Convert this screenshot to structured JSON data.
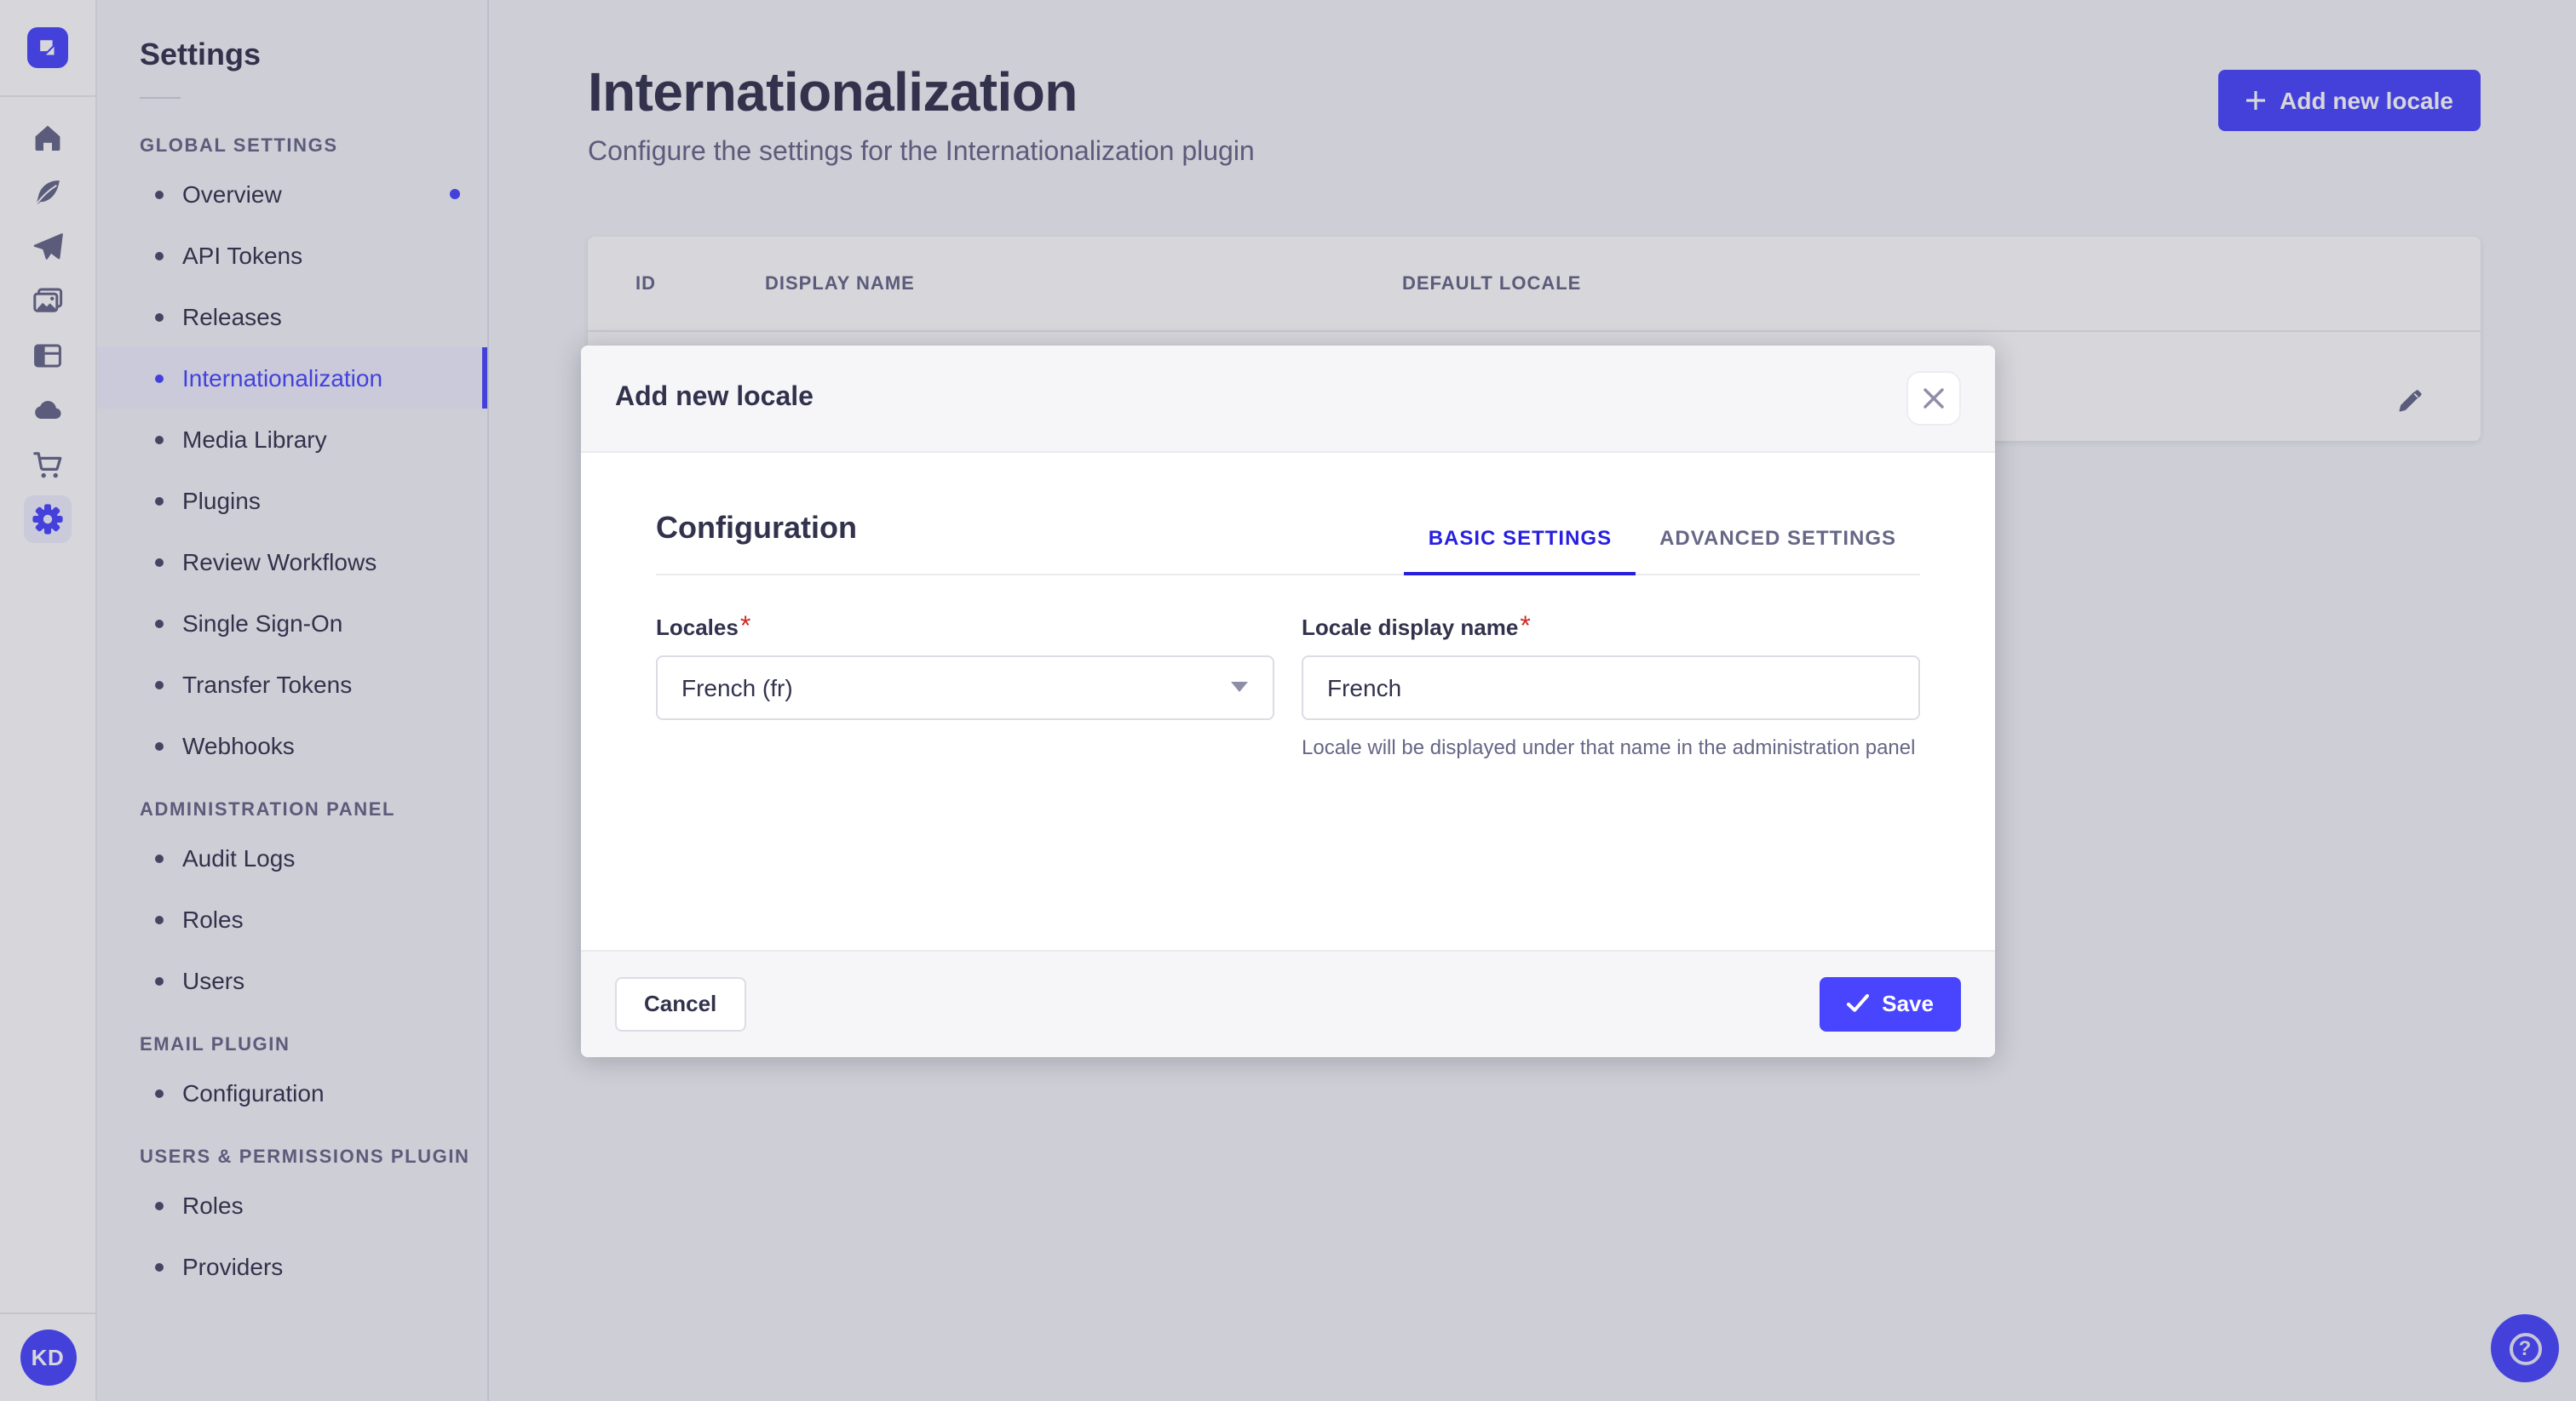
{
  "nav_rail": {
    "icons": [
      "home",
      "feather",
      "paper-plane",
      "media-library",
      "content-manager",
      "cloud",
      "marketplace-cart",
      "settings-gear"
    ],
    "active_icon": "settings-gear",
    "avatar_initials": "KD"
  },
  "sidebar": {
    "title": "Settings",
    "sections": [
      {
        "label": "GLOBAL SETTINGS",
        "items": [
          {
            "label": "Overview",
            "notification": true
          },
          {
            "label": "API Tokens"
          },
          {
            "label": "Releases"
          },
          {
            "label": "Internationalization",
            "active": true
          },
          {
            "label": "Media Library"
          },
          {
            "label": "Plugins"
          },
          {
            "label": "Review Workflows"
          },
          {
            "label": "Single Sign-On"
          },
          {
            "label": "Transfer Tokens"
          },
          {
            "label": "Webhooks"
          }
        ]
      },
      {
        "label": "ADMINISTRATION PANEL",
        "items": [
          {
            "label": "Audit Logs"
          },
          {
            "label": "Roles"
          },
          {
            "label": "Users"
          }
        ]
      },
      {
        "label": "EMAIL PLUGIN",
        "items": [
          {
            "label": "Configuration"
          }
        ]
      },
      {
        "label": "USERS & PERMISSIONS PLUGIN",
        "items": [
          {
            "label": "Roles"
          },
          {
            "label": "Providers"
          }
        ]
      }
    ]
  },
  "page": {
    "title": "Internationalization",
    "subtitle": "Configure the settings for the Internationalization plugin",
    "add_locale_button": "Add new locale"
  },
  "table": {
    "columns": [
      "ID",
      "DISPLAY NAME",
      "DEFAULT LOCALE"
    ]
  },
  "modal": {
    "title": "Add new locale",
    "section_title": "Configuration",
    "tabs": [
      {
        "label": "BASIC SETTINGS",
        "active": true
      },
      {
        "label": "ADVANCED SETTINGS",
        "active": false
      }
    ],
    "locales_field": {
      "label": "Locales",
      "required": "*",
      "value": "French (fr)"
    },
    "display_name_field": {
      "label": "Locale display name",
      "required": "*",
      "value": "French",
      "help": "Locale will be displayed under that name in the administration panel"
    },
    "footer": {
      "cancel": "Cancel",
      "save": "Save"
    }
  },
  "help": {
    "glyph": "?"
  },
  "colors": {
    "accent": "#4945ff",
    "accent_active_bg": "#f0f0ff",
    "active_tab": "#271fe0",
    "text_primary": "#32324d",
    "text_secondary": "#666687",
    "border": "#eaeaef",
    "required": "#d02b20"
  }
}
